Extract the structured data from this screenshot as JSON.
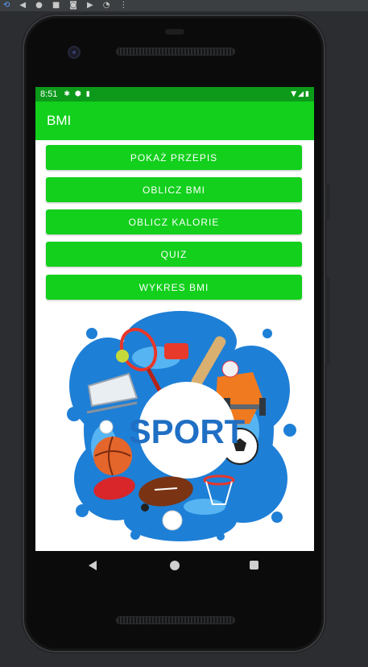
{
  "emulator_toolbar": {
    "icons": [
      "back-icon",
      "dot-icon",
      "stop-icon",
      "camera-icon",
      "video-icon",
      "timer-icon",
      "more-icon"
    ]
  },
  "status_bar": {
    "time": "8:51",
    "left_icons": [
      "gear-icon",
      "shield-icon",
      "sd-card-icon"
    ],
    "right_icons": [
      "wifi-icon",
      "signal-icon",
      "battery-icon"
    ]
  },
  "app_bar": {
    "title": "BMI",
    "color": "#12d01c"
  },
  "buttons": [
    {
      "label": "POKAŻ PRZEPIS"
    },
    {
      "label": "OBLICZ BMI"
    },
    {
      "label": "OBLICZ KALORIE"
    },
    {
      "label": "QUIZ"
    },
    {
      "label": "WYKRES BMI"
    }
  ],
  "illustration": {
    "text": "SPORT"
  },
  "nav_bar": {
    "icons": [
      "back-triangle-icon",
      "home-circle-icon",
      "recents-square-icon"
    ]
  },
  "colors": {
    "status_bar": "#0d9a1b",
    "accent": "#12d01c",
    "illustration_blue": "#1e7fd6"
  }
}
